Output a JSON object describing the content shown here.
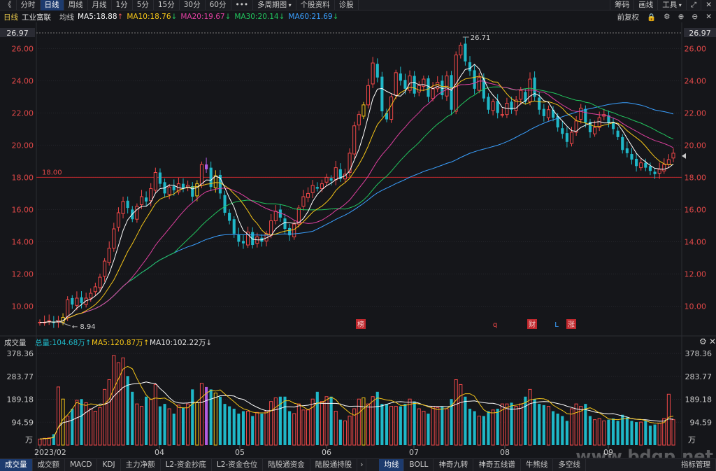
{
  "toolbar": {
    "back_glyph": "《",
    "tabs": [
      "分时",
      "日线",
      "周线",
      "月线",
      "1分",
      "5分",
      "15分",
      "30分",
      "60分",
      "•••",
      "多周期图",
      "个股资料",
      "诊股"
    ],
    "active_tab": 1,
    "right": [
      "筹码",
      "画线",
      "工具"
    ]
  },
  "kinfo": {
    "period": "日线",
    "stock_name": "工业富联",
    "ma_label": "均线",
    "ma": [
      {
        "text": "MA5:18.88",
        "dir": "↑",
        "color": "#ffffff"
      },
      {
        "text": "MA10:18.76",
        "dir": "↓",
        "color": "#f5c518"
      },
      {
        "text": "MA20:19.67",
        "dir": "↓",
        "color": "#e040a0"
      },
      {
        "text": "MA30:20.14",
        "dir": "↓",
        "color": "#22c55e"
      },
      {
        "text": "MA60:21.69",
        "dir": "↓",
        "color": "#3aa0ff"
      }
    ],
    "adjust": "前复权"
  },
  "price_axis": {
    "labels": [
      "26.00",
      "24.00",
      "22.00",
      "20.00",
      "18.00",
      "16.00",
      "14.00",
      "12.00",
      "10.00"
    ],
    "top_label": "26.97",
    "hline_label": "18.00",
    "high_label": "26.71",
    "low_label": "8.94"
  },
  "markers": [
    "榜",
    "q",
    "财",
    "L",
    "涨"
  ],
  "volume": {
    "title": "成交量",
    "total": "总量:104.68万",
    "total_dir": "↑",
    "ma5": "MA5:120.87万",
    "ma5_dir": "↑",
    "ma10": "MA10:102.22万",
    "ma10_dir": "↓",
    "labels": [
      "378.36",
      "283.77",
      "189.18",
      "94.59"
    ],
    "unit": "万"
  },
  "date_axis": [
    "2023/02",
    "04",
    "05",
    "06",
    "07",
    "08",
    "09"
  ],
  "bottom_tabs": [
    "成交量",
    "成交额",
    "MACD",
    "KDJ",
    "主力净额",
    "L2-资金抄底",
    "L2-资金仓位",
    "陆股通资金",
    "陆股通持股"
  ],
  "bottom_tabs_right": [
    "均线",
    "BOLL",
    "神奇九转",
    "神奇五线谱",
    "牛熊线",
    "多空线"
  ],
  "bottom_end": [
    "指标管理"
  ],
  "watermark": "www.bdgp.net",
  "colors": {
    "up": "#f04848",
    "down": "#1fb8c8",
    "ma5": "#ffffff",
    "ma10": "#f5c518",
    "ma20": "#e040a0",
    "ma30": "#22c55e",
    "ma60": "#3aa0ff",
    "hline": "#c0282d"
  },
  "chart_data": {
    "type": "candlestick",
    "ylim": [
      8.5,
      26.97
    ],
    "closes": [
      9.0,
      9.0,
      9.1,
      8.95,
      9.1,
      9.3,
      10.4,
      10.1,
      10.5,
      10.2,
      10.5,
      10.8,
      11.2,
      11.8,
      12.8,
      13.6,
      14.8,
      15.8,
      16.5,
      16.1,
      15.4,
      16.2,
      16.8,
      16.5,
      17.3,
      18.3,
      17.6,
      17.0,
      17.4,
      17.2,
      17.6,
      17.3,
      17.5,
      16.8,
      17.6,
      18.8,
      18.5,
      17.4,
      18.1,
      17.0,
      15.8,
      15.3,
      14.5,
      14.0,
      13.9,
      14.6,
      13.8,
      14.3,
      14.0,
      14.5,
      15.3,
      15.9,
      15.5,
      14.8,
      14.4,
      15.1,
      16.1,
      16.8,
      17.0,
      17.5,
      17.3,
      17.6,
      18.0,
      17.8,
      18.6,
      17.9,
      18.2,
      19.5,
      21.2,
      21.9,
      22.5,
      23.7,
      25.1,
      24.2,
      22.1,
      21.6,
      23.0,
      24.5,
      24.0,
      23.5,
      24.3,
      23.2,
      23.7,
      24.1,
      23.0,
      23.5,
      23.9,
      23.1,
      24.3,
      22.2,
      25.6,
      26.2,
      25.2,
      24.6,
      23.5,
      24.2,
      22.9,
      22.2,
      22.7,
      22.0,
      21.9,
      22.6,
      22.2,
      22.8,
      23.4,
      22.7,
      24.1,
      23.0,
      22.2,
      21.8,
      22.2,
      21.7,
      21.1,
      20.7,
      20.2,
      20.8,
      21.5,
      22.3,
      21.4,
      20.8,
      21.1,
      21.7,
      21.9,
      21.4,
      21.0,
      20.5,
      19.7,
      19.5,
      19.1,
      18.7,
      18.9,
      18.6,
      18.4,
      18.2,
      18.5,
      18.8,
      19.1,
      19.5
    ],
    "volumes": [
      25,
      28,
      30,
      45,
      240,
      190,
      120,
      150,
      185,
      190,
      175,
      150,
      140,
      155,
      230,
      270,
      370,
      340,
      360,
      285,
      220,
      170,
      160,
      200,
      190,
      250,
      160,
      170,
      150,
      130,
      165,
      155,
      170,
      230,
      175,
      255,
      240,
      230,
      215,
      200,
      170,
      160,
      150,
      130,
      140,
      140,
      120,
      135,
      130,
      140,
      180,
      195,
      200,
      200,
      140,
      130,
      170,
      145,
      145,
      190,
      220,
      180,
      200,
      200,
      140,
      105,
      100,
      120,
      150,
      190,
      195,
      170,
      200,
      220,
      170,
      170,
      160,
      160,
      160,
      170,
      190,
      180,
      150,
      140,
      130,
      160,
      155,
      160,
      150,
      190,
      270,
      250,
      200,
      150,
      140,
      120,
      120,
      140,
      145,
      150,
      170,
      170,
      175,
      160,
      170,
      200,
      230,
      190,
      170,
      165,
      160,
      140,
      130,
      120,
      100,
      150,
      170,
      160,
      170,
      120,
      105,
      110,
      100,
      105,
      110,
      100,
      125,
      115,
      100,
      95,
      95,
      100,
      80,
      85,
      90,
      110,
      210,
      105
    ]
  }
}
